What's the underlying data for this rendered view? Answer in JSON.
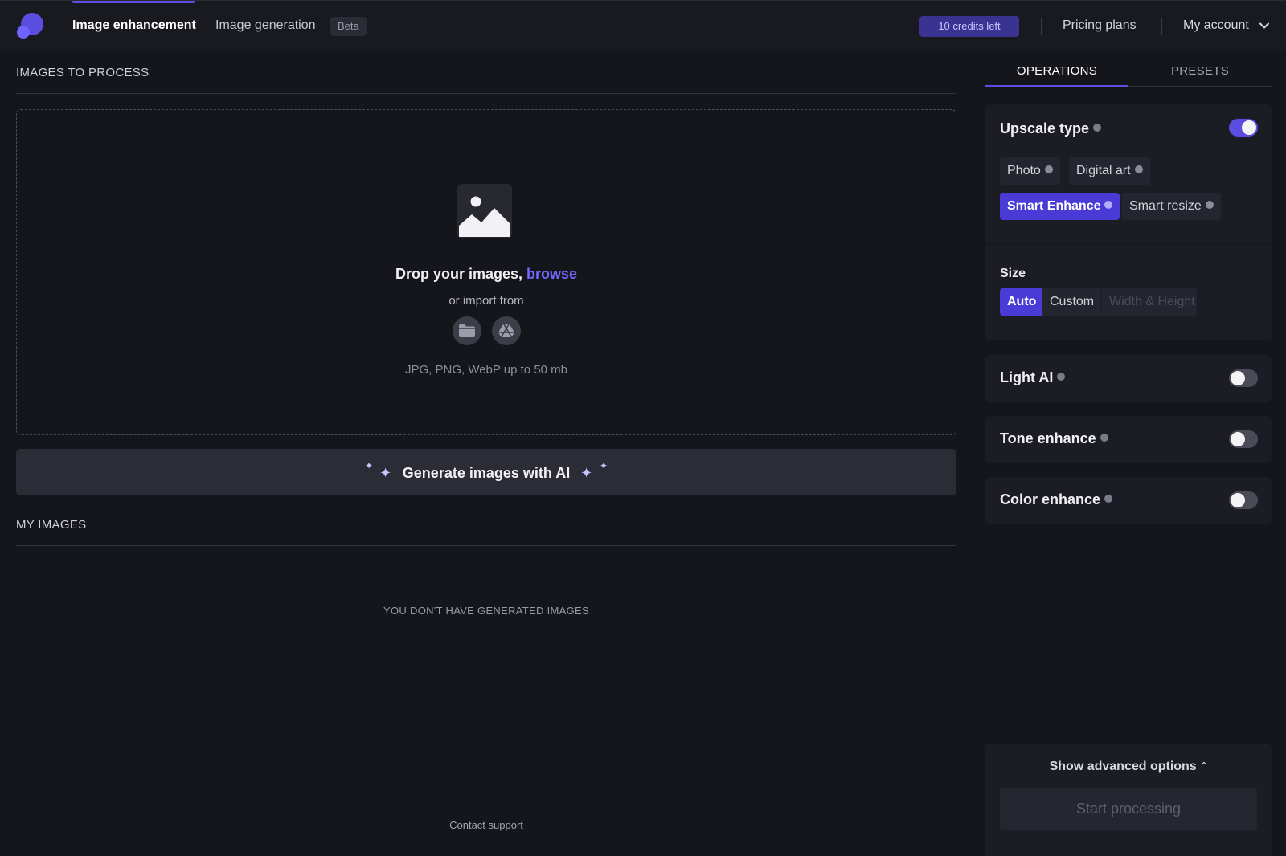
{
  "header": {
    "nav_active": "Image enhancement",
    "nav_generation": "Image generation",
    "beta_badge": "Beta",
    "credits": "10 credits left",
    "pricing": "Pricing plans",
    "account": "My account"
  },
  "upload": {
    "section_title": "IMAGES TO PROCESS",
    "drop_text": "Drop your images, ",
    "browse_link": "browse",
    "import_text": "or import from",
    "formats": "JPG, PNG, WebP up to 50 mb",
    "import_sources": [
      "folder-icon",
      "google-drive-icon"
    ]
  },
  "generate": {
    "label": "Generate images with AI"
  },
  "my_images": {
    "section_title": "MY IMAGES",
    "empty_text": "YOU DON'T HAVE GENERATED IMAGES"
  },
  "footer": {
    "support": "Contact support"
  },
  "panel": {
    "tabs": {
      "operations": "OPERATIONS",
      "presets": "PRESETS"
    },
    "upscale": {
      "title": "Upscale type",
      "enabled": true,
      "types": [
        "Photo",
        "Digital art",
        "Smart Enhance",
        "Smart resize"
      ],
      "selected": "Smart Enhance"
    },
    "size": {
      "title": "Size",
      "options": [
        "Auto",
        "Custom"
      ],
      "selected": "Auto",
      "width_height_placeholder": "Width & Height"
    },
    "light_ai": {
      "title": "Light AI",
      "enabled": false
    },
    "tone_enhance": {
      "title": "Tone enhance",
      "enabled": false
    },
    "color_enhance": {
      "title": "Color enhance",
      "enabled": false
    },
    "advanced": "Show advanced options",
    "start": "Start processing"
  },
  "colors": {
    "accent": "#5b4de0",
    "background": "#15161b",
    "card": "#1c1d24",
    "link": "#7366ff"
  }
}
